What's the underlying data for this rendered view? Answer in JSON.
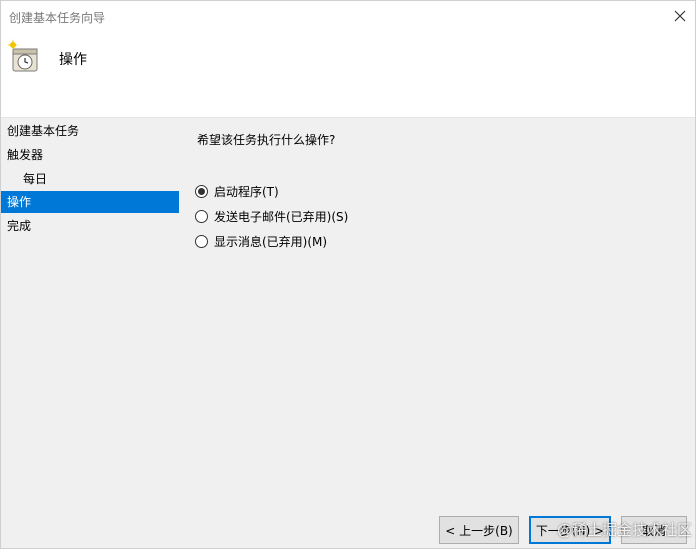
{
  "window": {
    "title": "创建基本任务向导"
  },
  "header": {
    "title": "操作",
    "icon": "task-clock-icon"
  },
  "nav": {
    "items": [
      {
        "label": "创建基本任务",
        "level": 0,
        "selected": false
      },
      {
        "label": "触发器",
        "level": 0,
        "selected": false
      },
      {
        "label": "每日",
        "level": 1,
        "selected": false
      },
      {
        "label": "操作",
        "level": 0,
        "selected": true
      },
      {
        "label": "完成",
        "level": 0,
        "selected": false
      }
    ]
  },
  "main": {
    "question": "希望该任务执行什么操作?",
    "options": [
      {
        "label": "启动程序(T)",
        "checked": true
      },
      {
        "label": "发送电子邮件(已弃用)(S)",
        "checked": false
      },
      {
        "label": "显示消息(已弃用)(M)",
        "checked": false
      }
    ]
  },
  "buttons": {
    "back": "< 上一步(B)",
    "next": "下一步(N) >",
    "cancel": "取消"
  },
  "watermark": {
    "text": "@稀土掘金技术社区"
  },
  "colors": {
    "accent": "#0078d7",
    "background": "#f0f0f0",
    "header": "#ffffff"
  }
}
